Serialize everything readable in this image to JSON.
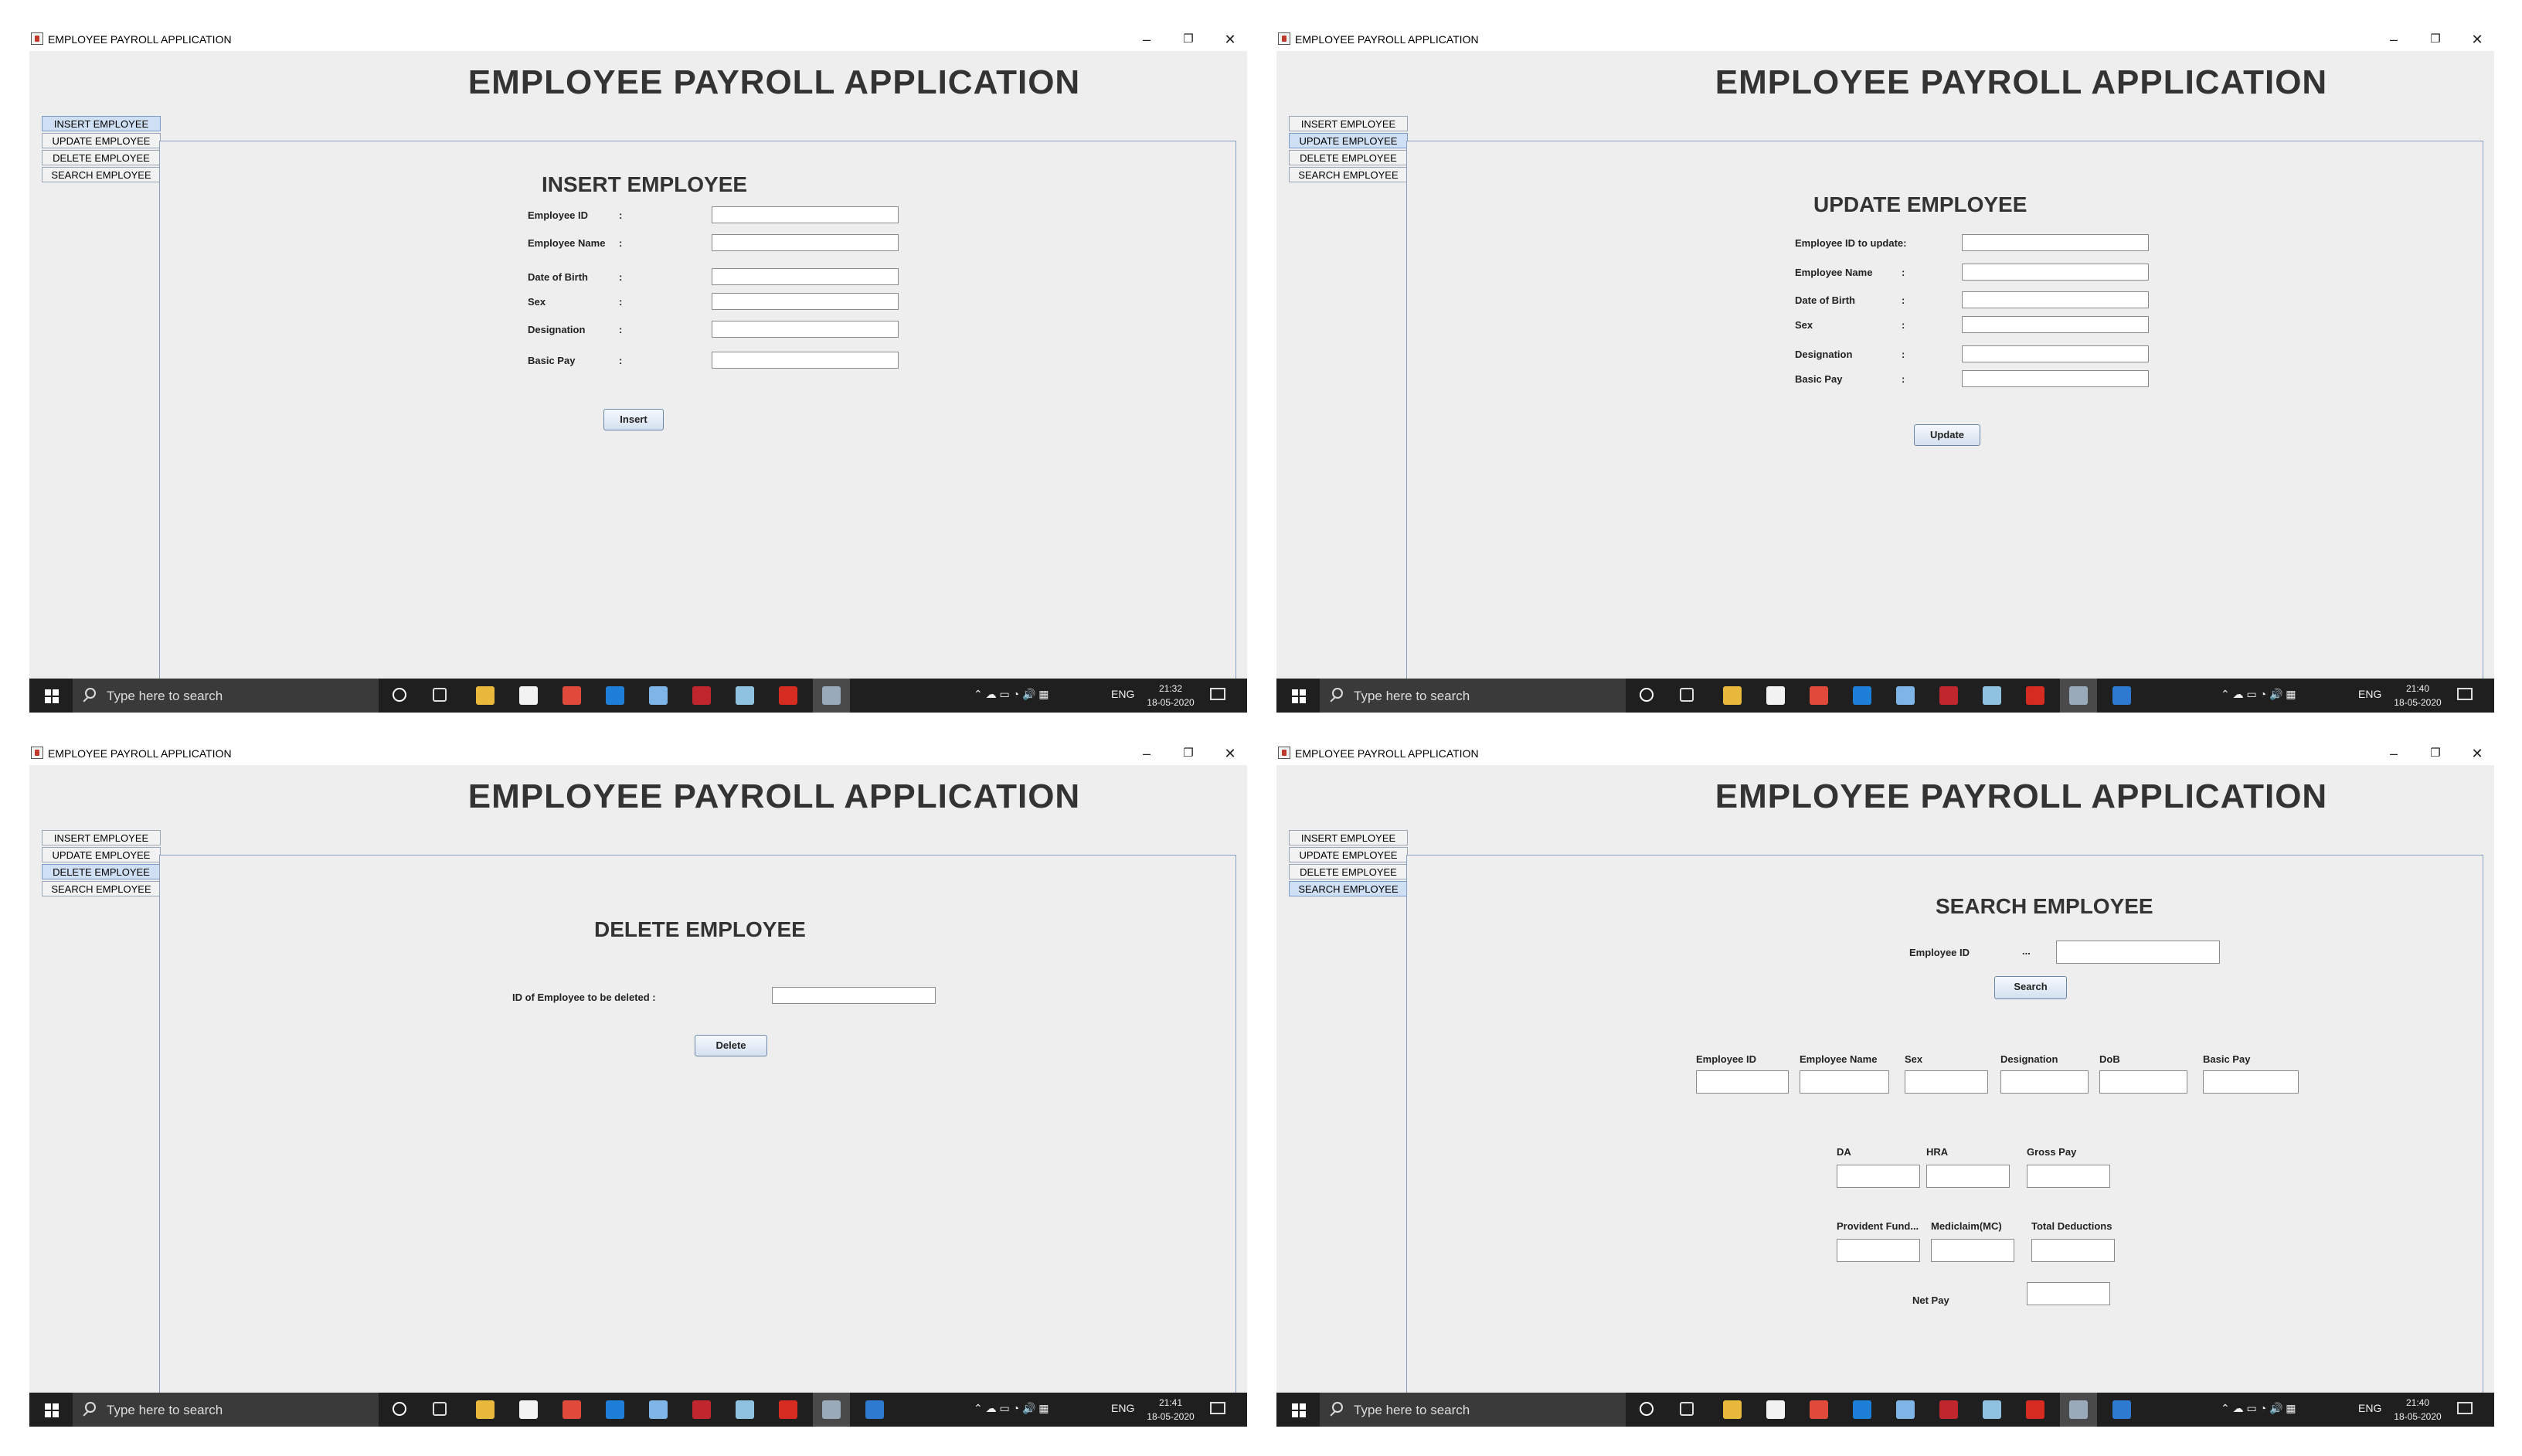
{
  "window": {
    "title": "EMPLOYEE PAYROLL APPLICATION",
    "app_title": "EMPLOYEE PAYROLL APPLICATION",
    "controls": {
      "minimize": "–",
      "maximize": "❐",
      "close": "✕"
    }
  },
  "tabs": [
    "INSERT EMPLOYEE",
    "UPDATE EMPLOYEE",
    "DELETE EMPLOYEE",
    "SEARCH EMPLOYEE"
  ],
  "insert": {
    "heading": "INSERT EMPLOYEE",
    "labels": [
      "Employee ID",
      "Employee Name",
      "Date of Birth",
      "Sex",
      "Designation",
      "Basic Pay"
    ],
    "colon": ":",
    "button": "Insert"
  },
  "update": {
    "heading": "UPDATE EMPLOYEE",
    "labels": [
      "Employee ID to update:",
      "Employee Name",
      "Date of Birth",
      "Sex",
      "Designation",
      "Basic Pay"
    ],
    "colon": ":",
    "button": "Update"
  },
  "delete": {
    "heading": "DELETE EMPLOYEE",
    "label": "ID of Employee to be deleted :",
    "button": "Delete"
  },
  "search": {
    "heading": "SEARCH EMPLOYEE",
    "id_label": "Employee ID",
    "id_sep": "...",
    "button": "Search",
    "row1": [
      "Employee ID",
      "Employee Name",
      "Sex",
      "Designation",
      "DoB",
      "Basic Pay"
    ],
    "row2": [
      "DA",
      "HRA",
      "Gross Pay"
    ],
    "row3": [
      "Provident Fund...",
      "Mediclaim(MC)",
      "Total Deductions"
    ],
    "net_label": "Net Pay"
  },
  "taskbar": {
    "search_placeholder": "Type here to search",
    "language": "ENG",
    "clocks": [
      {
        "time": "21:32",
        "date": "18-05-2020"
      },
      {
        "time": "21:40",
        "date": "18-05-2020"
      },
      {
        "time": "21:41",
        "date": "18-05-2020"
      },
      {
        "time": "21:40",
        "date": "18-05-2020"
      }
    ],
    "icons": [
      "cortana-icon",
      "task-view-icon",
      "file-explorer-icon",
      "store-icon",
      "chrome-icon",
      "edge-icon",
      "box-icon",
      "mcafee-icon",
      "notepad-icon",
      "acrobat-icon",
      "java-icon",
      "app-icon"
    ],
    "icon_colors": {
      "file-explorer-icon": "#e8b93a",
      "store-icon": "#f2f2f2",
      "chrome-icon": "#e04a3a",
      "edge-icon": "#1e7fd8",
      "box-icon": "#7fb4e6",
      "mcafee-icon": "#c0262d",
      "notepad-icon": "#8fc1e0",
      "acrobat-icon": "#d62b21",
      "java-icon": "#9ab",
      "app-icon": "#2e7ad0"
    }
  }
}
